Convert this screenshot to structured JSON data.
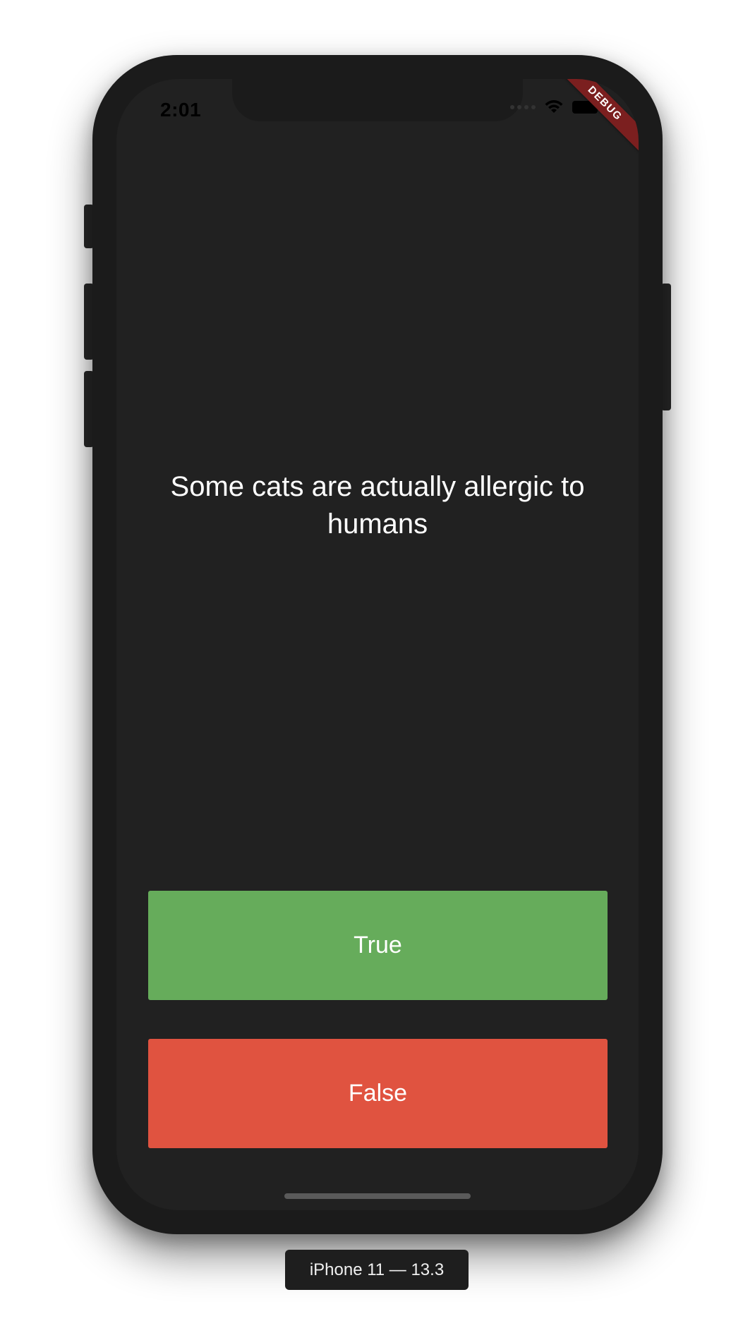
{
  "status_bar": {
    "time": "2:01",
    "icons": [
      "cellular-signal-icon",
      "wifi-icon",
      "battery-icon"
    ]
  },
  "debug_banner": {
    "label": "DEBUG",
    "color": "#7b1f1f"
  },
  "quiz": {
    "question": "Some cats are actually allergic to humans",
    "buttons": {
      "true_label": "True",
      "false_label": "False"
    }
  },
  "colors": {
    "screen_background": "#212121",
    "true_button": "#66ac5b",
    "false_button": "#e05340"
  },
  "simulator": {
    "device_label": "iPhone 11 — 13.3"
  }
}
